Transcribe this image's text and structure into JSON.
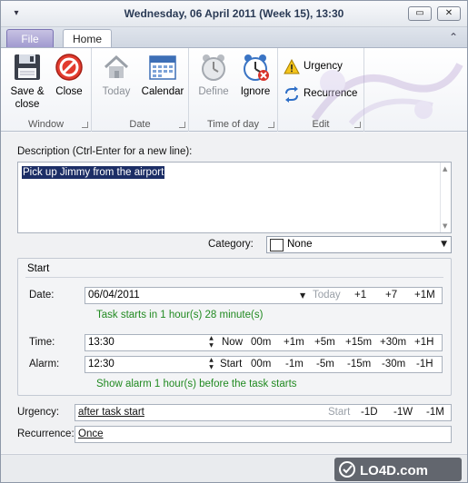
{
  "window": {
    "title": "Wednesday, 06 April 2011 (Week 15), 13:30",
    "qat_symbol": "▾",
    "minimize_symbol": "▭",
    "close_symbol": "✕"
  },
  "ribbon": {
    "tabs": [
      {
        "label": "File"
      },
      {
        "label": "Home"
      }
    ],
    "collapse_symbol": "⌃",
    "groups": {
      "window": {
        "label": "Window",
        "save_label": "Save &\nclose",
        "close_label": "Close"
      },
      "date": {
        "label": "Date",
        "today_label": "Today",
        "calendar_label": "Calendar"
      },
      "time_of_day": {
        "label": "Time of day",
        "define_label": "Define",
        "ignore_label": "Ignore"
      },
      "edit": {
        "label": "Edit",
        "urgency_label": "Urgency",
        "recurrence_label": "Recurrence"
      }
    }
  },
  "form": {
    "description_label": "Description (Ctrl-Enter for a new line):",
    "description_value": "Pick up Jimmy from the airport",
    "category_label": "Category:",
    "category_value": "None",
    "start_header": "Start",
    "date_label": "Date:",
    "date_value": "06/04/2011",
    "date_quick": {
      "today": "Today",
      "p1": "+1",
      "p7": "+7",
      "p1m": "+1M"
    },
    "task_hint": "Task starts in 1 hour(s) 28 minute(s)",
    "time_label": "Time:",
    "time_value": "13:30",
    "time_quick": {
      "now": "Now",
      "m00": "00m",
      "p1m": "+1m",
      "p5m": "+5m",
      "p15m": "+15m",
      "p30m": "+30m",
      "p1h": "+1H"
    },
    "alarm_label": "Alarm:",
    "alarm_value": "12:30",
    "alarm_quick": {
      "start": "Start",
      "m00": "00m",
      "m1m": "-1m",
      "m5m": "-5m",
      "m15m": "-15m",
      "m30m": "-30m",
      "m1h": "-1H"
    },
    "alarm_hint": "Show alarm 1 hour(s) before the task starts",
    "urgency_label": "Urgency:",
    "urgency_value": "after task start",
    "urgency_quick": {
      "start": "Start",
      "m1d": "-1D",
      "m1w": "-1W",
      "m1m": "-1M"
    },
    "recurrence_label": "Recurrence:",
    "recurrence_value": "Once"
  },
  "watermark": {
    "text": "LO4D.com"
  },
  "colors": {
    "hint_green": "#218a21",
    "selection": "#1c2e66",
    "file_tab": "#a29bd1"
  }
}
